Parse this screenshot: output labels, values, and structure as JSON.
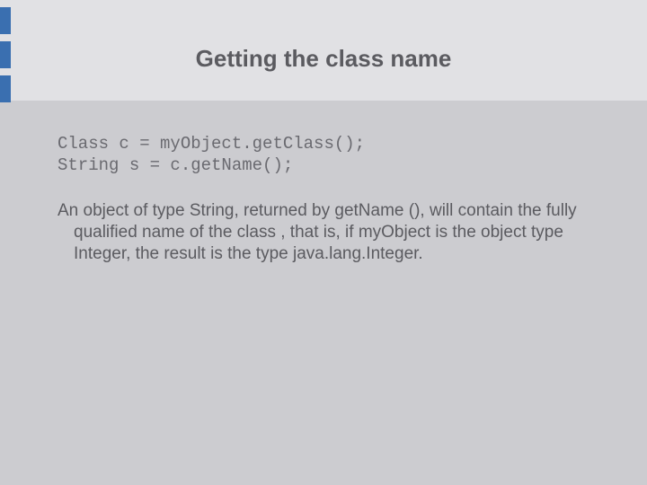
{
  "slide": {
    "title": "Getting the class name",
    "code_line1": "Class c = myObject.getClass();",
    "code_line2": "String s = c.getName();",
    "paragraph": "An object of type String, returned by getName (), will contain the fully qualified name of the class , that is, if myObject is the object type Integer, the result is the type java.lang.Integer."
  }
}
